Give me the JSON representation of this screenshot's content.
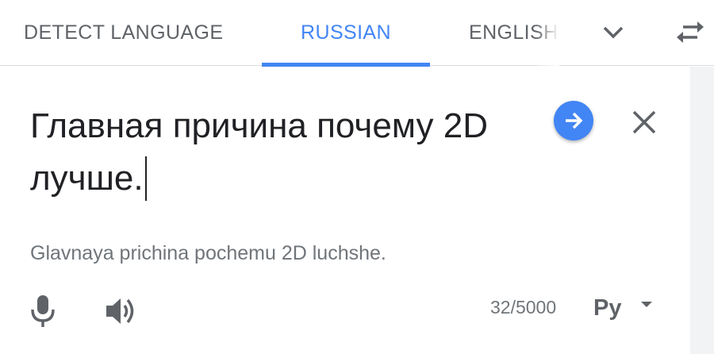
{
  "lang_tabs": {
    "detect": "DETECT LANGUAGE",
    "source_selected": "RUSSIAN",
    "target": "ENGLISH"
  },
  "source": {
    "text": "Главная причина почему 2D лучше.",
    "transliteration": "Glavnaya prichina pochemu 2D luchshe.",
    "char_count": "32/5000",
    "ime_label": "Ру"
  },
  "icons": {
    "more": "chevron-down-icon",
    "swap": "swap-arrows-icon",
    "translate": "arrow-right-icon",
    "clear": "close-icon",
    "mic": "microphone-icon",
    "speaker": "speaker-icon",
    "ime_dropdown": "caret-down-icon"
  },
  "colors": {
    "accent": "#4285f4",
    "text_primary": "#202124",
    "text_secondary": "#70757a",
    "icon": "#5f6368"
  }
}
